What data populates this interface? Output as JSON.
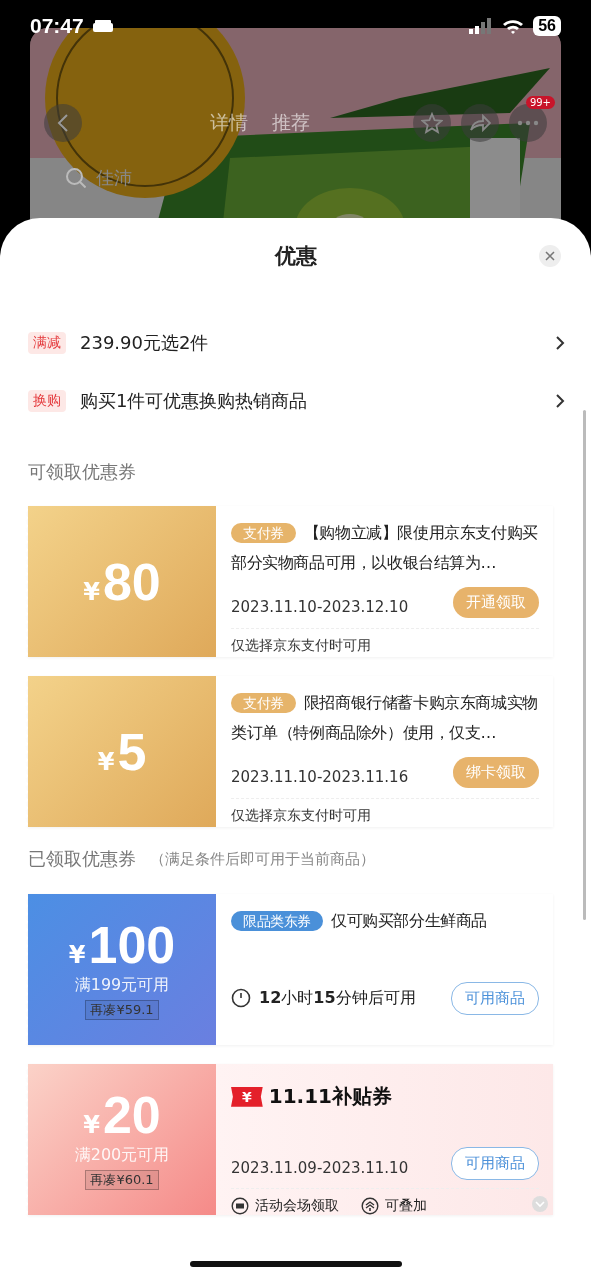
{
  "status_bar": {
    "time": "07:47",
    "battery": "56"
  },
  "product_header": {
    "tabs": [
      {
        "label": "详情",
        "selected": false
      },
      {
        "label": "推荐",
        "selected": false
      }
    ],
    "badge": "99+",
    "search": {
      "placeholder": "佳沛"
    }
  },
  "sheet": {
    "title": "优惠",
    "promotions": [
      {
        "tag": "满减",
        "text": "239.90元选2件"
      },
      {
        "tag": "换购",
        "text": "购买1件可优惠换购热销商品"
      }
    ],
    "available_section": {
      "title": "可领取优惠券",
      "coupons": [
        {
          "kind": "pay",
          "currency": "¥",
          "amount": "80",
          "tag": "支付券",
          "description": "【购物立减】限使用京东支付购买部分实物商品可用，以收银台结算为…",
          "dates": "2023.11.10-2023.12.10",
          "action": "开通领取",
          "note": "仅选择京东支付时可用"
        },
        {
          "kind": "pay",
          "currency": "¥",
          "amount": "5",
          "tag": "支付券",
          "description": "限招商银行储蓄卡购京东商城实物类订单（特例商品除外）使用，仅支…",
          "dates": "2023.11.10-2023.11.16",
          "action": "绑卡领取",
          "note": "仅选择京东支付时可用"
        }
      ]
    },
    "claimed_section": {
      "title": "已领取优惠券",
      "note": "（满足条件后即可用于当前商品）",
      "coupons": [
        {
          "kind": "category",
          "currency": "¥",
          "amount": "100",
          "condition": "满199元可用",
          "topup": "再凑¥59.1",
          "tag": "限品类东券",
          "description": "仅可购买部分生鲜商品",
          "timer": "**12**小时**15**分钟后可用",
          "action": "可用商品"
        },
        {
          "kind": "subsidy",
          "currency": "¥",
          "amount": "20",
          "condition": "满200元可用",
          "topup": "再凑¥60.1",
          "logo_mark": "¥",
          "logo_text": "11.11补贴券",
          "dates": "2023.11.09-2023.11.10",
          "action": "可用商品",
          "features": [
            "活动会场领取",
            "可叠加"
          ]
        }
      ]
    }
  }
}
